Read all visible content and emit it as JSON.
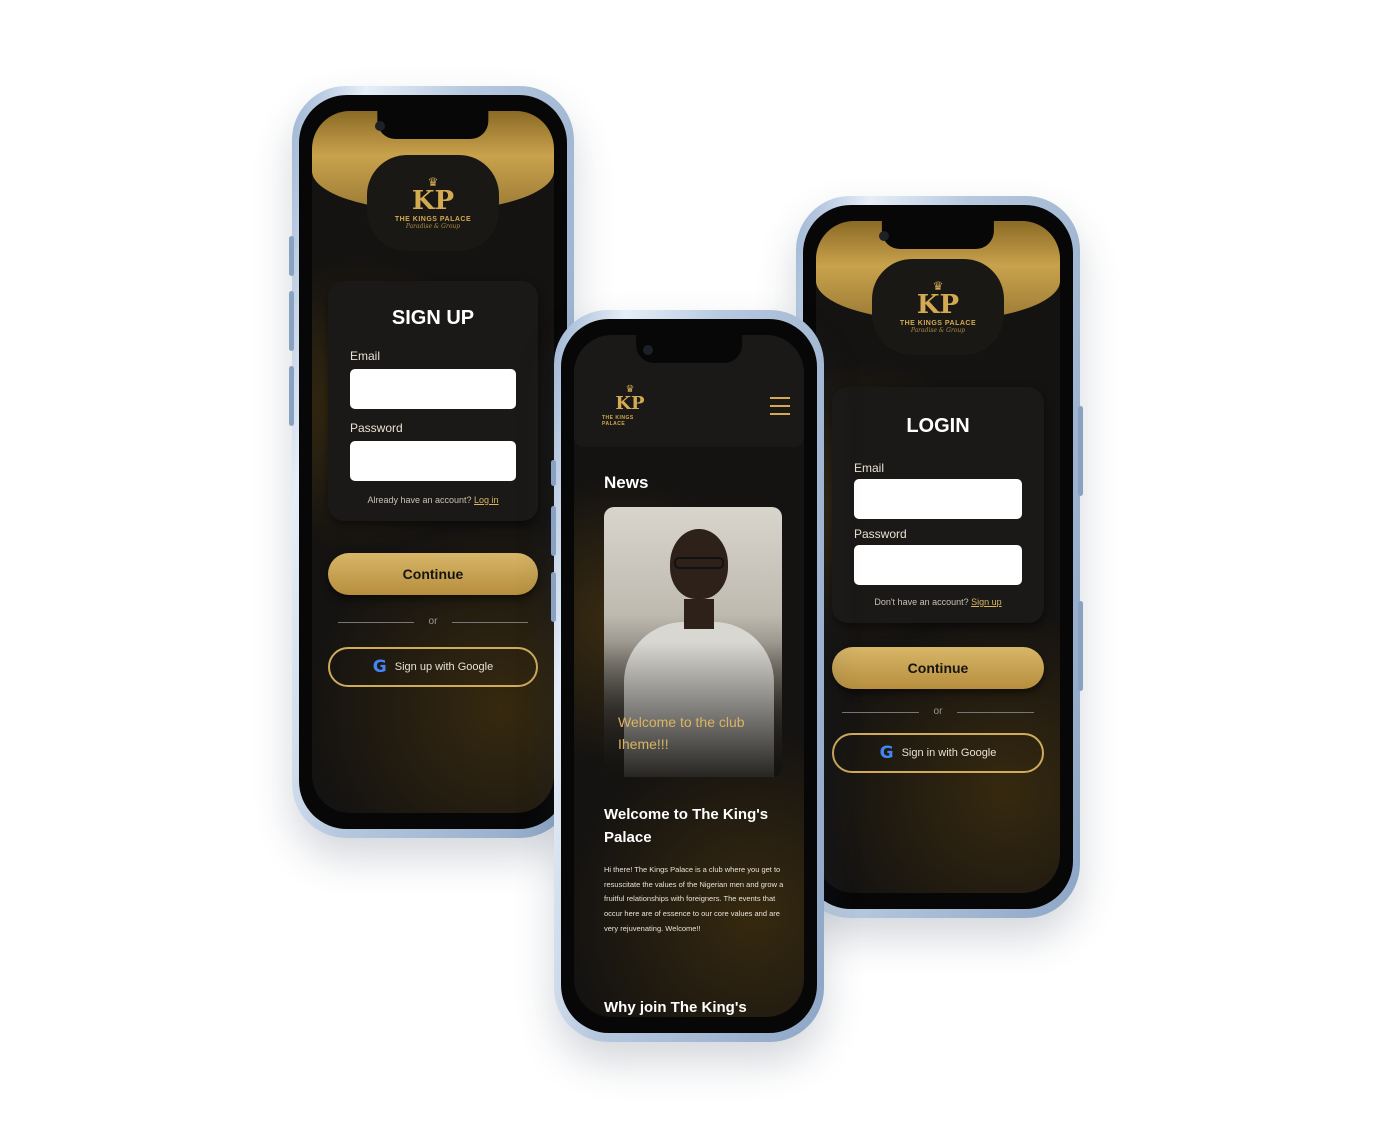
{
  "brand": {
    "mark": "KP",
    "crown": "♛",
    "name": "THE KINGS PALACE",
    "tagline": "Paradise & Group"
  },
  "signup": {
    "title": "SIGN UP",
    "email_label": "Email",
    "password_label": "Password",
    "account_prompt": "Already have an account?",
    "account_link": "Log in",
    "continue_label": "Continue",
    "or_label": "or",
    "google_label": "Sign up with Google"
  },
  "home": {
    "news_title": "News",
    "news_caption": "Welcome to the club Iheme!!!",
    "welcome_title": "Welcome to The King's Palace",
    "welcome_body": "Hi there! The Kings Palace is a club where you get to resuscitate the values of the Nigerian men and grow a fruitful relationships with foreigners. The events that occur here are of essence to our core values and are very rejuvenating. Welcome!!",
    "why_title": "Why join The King's Palace?"
  },
  "login": {
    "title": "LOGIN",
    "email_label": "Email",
    "password_label": "Password",
    "account_prompt": "Don't have an account?",
    "account_link": "Sign up",
    "continue_label": "Continue",
    "or_label": "or",
    "google_label": "Sign in with Google"
  },
  "colors": {
    "gold": "#d3aa52",
    "dark": "#151311",
    "card": "#1b1917"
  },
  "icons": {
    "google": "G",
    "menu": "hamburger-icon"
  }
}
